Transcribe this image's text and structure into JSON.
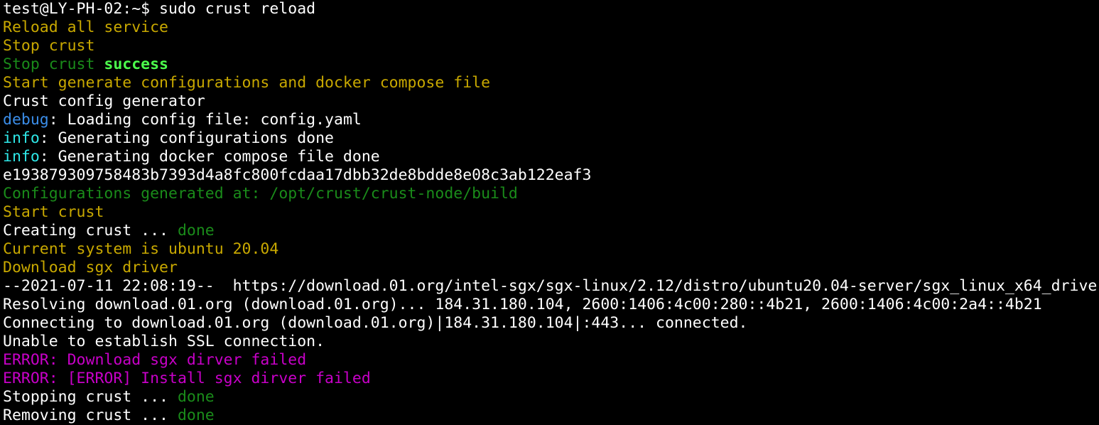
{
  "colors": {
    "background": "#000000",
    "white": "#ffffff",
    "yellow": "#c8a800",
    "dark_green": "#1a8b1a",
    "bright_green": "#4cff4c",
    "blue": "#3b8eea",
    "cyan": "#2ee8e8",
    "magenta": "#c800c8"
  },
  "terminal": {
    "lines": [
      {
        "segments": [
          {
            "text": "test@LY-PH-02:~$ sudo crust reload",
            "color": "white"
          }
        ]
      },
      {
        "segments": [
          {
            "text": "Reload all service",
            "color": "yellow"
          }
        ]
      },
      {
        "segments": [
          {
            "text": "Stop crust",
            "color": "yellow"
          }
        ]
      },
      {
        "segments": [
          {
            "text": "Stop crust ",
            "color": "dark_green"
          },
          {
            "text": "success",
            "color": "bright_green",
            "bold": true
          }
        ]
      },
      {
        "segments": [
          {
            "text": "Start generate configurations and docker compose file",
            "color": "yellow"
          }
        ]
      },
      {
        "segments": [
          {
            "text": "Crust config generator",
            "color": "white"
          }
        ]
      },
      {
        "segments": [
          {
            "text": "debug",
            "color": "blue"
          },
          {
            "text": ": Loading config file: config.yaml",
            "color": "white"
          }
        ]
      },
      {
        "segments": [
          {
            "text": "info",
            "color": "cyan"
          },
          {
            "text": ": Generating configurations done",
            "color": "white"
          }
        ]
      },
      {
        "segments": [
          {
            "text": "info",
            "color": "cyan"
          },
          {
            "text": ": Generating docker compose file done",
            "color": "white"
          }
        ]
      },
      {
        "segments": [
          {
            "text": "e193879309758483b7393d4a8fc800fcdaa17dbb32de8bdde8e08c3ab122eaf3",
            "color": "white"
          }
        ]
      },
      {
        "segments": [
          {
            "text": "Configurations generated at: /opt/crust/crust-node/build",
            "color": "dark_green"
          }
        ]
      },
      {
        "segments": [
          {
            "text": "Start crust",
            "color": "yellow"
          }
        ]
      },
      {
        "segments": [
          {
            "text": "Creating crust ... ",
            "color": "white"
          },
          {
            "text": "done",
            "color": "dark_green"
          }
        ]
      },
      {
        "segments": [
          {
            "text": "Current system is ubuntu 20.04",
            "color": "yellow"
          }
        ]
      },
      {
        "segments": [
          {
            "text": "Download sgx driver",
            "color": "yellow"
          }
        ]
      },
      {
        "segments": [
          {
            "text": "--2021-07-11 22:08:19--  https://download.01.org/intel-sgx/sgx-linux/2.12/distro/ubuntu20.04-server/sgx_linux_x64_drive",
            "color": "white"
          }
        ]
      },
      {
        "segments": [
          {
            "text": "Resolving download.01.org (download.01.org)... 184.31.180.104, 2600:1406:4c00:280::4b21, 2600:1406:4c00:2a4::4b21",
            "color": "white"
          }
        ]
      },
      {
        "segments": [
          {
            "text": "Connecting to download.01.org (download.01.org)|184.31.180.104|:443... connected.",
            "color": "white"
          }
        ]
      },
      {
        "segments": [
          {
            "text": "Unable to establish SSL connection.",
            "color": "white"
          }
        ]
      },
      {
        "segments": [
          {
            "text": "ERROR: Download sgx dirver failed",
            "color": "magenta"
          }
        ]
      },
      {
        "segments": [
          {
            "text": "ERROR: [ERROR] Install sgx dirver failed",
            "color": "magenta"
          }
        ]
      },
      {
        "segments": [
          {
            "text": "Stopping crust ... ",
            "color": "white"
          },
          {
            "text": "done",
            "color": "dark_green"
          }
        ]
      },
      {
        "segments": [
          {
            "text": "Removing crust ... ",
            "color": "white"
          },
          {
            "text": "done",
            "color": "dark_green"
          }
        ]
      }
    ]
  }
}
